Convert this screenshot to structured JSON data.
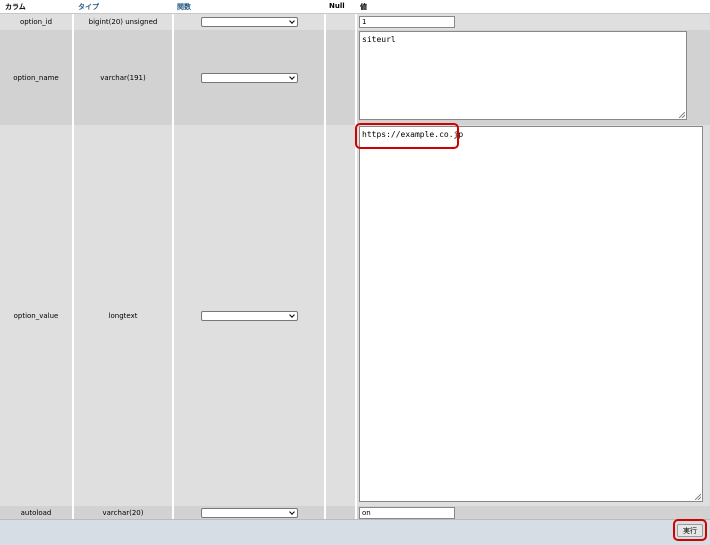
{
  "header": {
    "column": "カラム",
    "type": "タイプ",
    "function": "関数",
    "null": "Null",
    "value": "値"
  },
  "rows": [
    {
      "column": "option_id",
      "type": "bigint(20) unsigned",
      "function": "",
      "value": "1"
    },
    {
      "column": "option_name",
      "type": "varchar(191)",
      "function": "",
      "value": "siteurl"
    },
    {
      "column": "option_value",
      "type": "longtext",
      "function": "",
      "value": "https://example.co.jp"
    },
    {
      "column": "autoload",
      "type": "varchar(20)",
      "function": "",
      "value": "on"
    }
  ],
  "footer": {
    "go_label": "実行"
  },
  "colors": {
    "highlight": "#d40000",
    "header_link": "#235a81",
    "footer_bg": "#d6dde4"
  },
  "icons": {
    "select_arrow": "chevron-down-icon",
    "resize": "resize-grip-icon"
  }
}
